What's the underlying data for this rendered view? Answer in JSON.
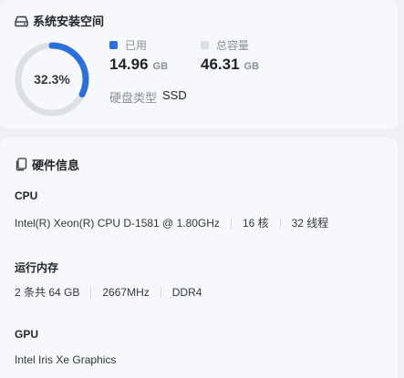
{
  "storage": {
    "title": "系统安装空间",
    "percent_label": "32.3%",
    "percent": 32.3,
    "used": {
      "legend": "已用",
      "value": "14.96",
      "unit": "GB",
      "color": "#2b6fdb"
    },
    "total": {
      "legend": "总容量",
      "value": "46.31",
      "unit": "GB",
      "color": "#dcdfe4"
    },
    "disk_type_label": "硬盘类型",
    "disk_type_value": "SSD",
    "icon": "drive-icon"
  },
  "hardware": {
    "title": "硬件信息",
    "icon": "device-icon",
    "cpu": {
      "heading": "CPU",
      "model": "Intel(R) Xeon(R) CPU D-1581 @ 1.80GHz",
      "cores": "16 核",
      "threads": "32 线程"
    },
    "memory": {
      "heading": "运行内存",
      "modules": "2 条共 64 GB",
      "speed": "2667MHz",
      "type": "DDR4"
    },
    "gpu": {
      "heading": "GPU",
      "model": "Intel Iris Xe Graphics"
    }
  }
}
